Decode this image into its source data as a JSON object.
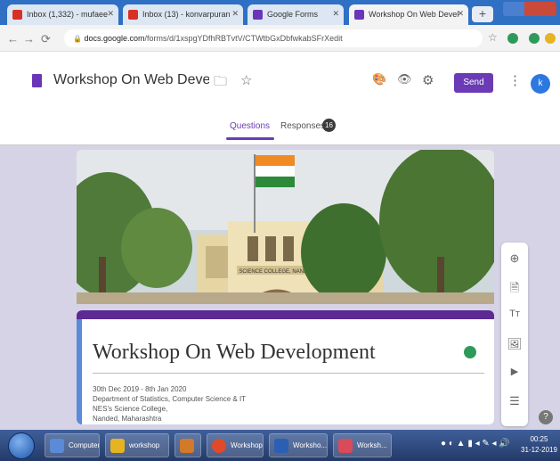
{
  "browser": {
    "tabs": [
      {
        "label": "Inbox (1,332) - mufaee",
        "favicon_color": "#d93025"
      },
      {
        "label": "Inbox (13) - konvarpuran",
        "favicon_color": "#d93025"
      },
      {
        "label": "Google Forms",
        "favicon_color": "#6a36b8"
      },
      {
        "label": "Workshop On Web Devel",
        "favicon_color": "#6a36b8"
      }
    ],
    "active_tab_index": 3,
    "new_tab_label": "+",
    "url_host": "docs.google.com",
    "url_path": "/forms/d/1xspgYDfhRBTvtV/CTWtbGxDbfwkabSFrXedit",
    "nav": {
      "back": "←",
      "forward": "→",
      "reload": "⟳",
      "lock": "🔒"
    },
    "star_icon": "☆"
  },
  "forms_header": {
    "title": "Workshop On Web Developr",
    "folder_icon": "🗀",
    "star_icon": "☆",
    "palette_icon": "🎨",
    "preview_icon": "👁",
    "settings_icon": "⚙",
    "send_label": "Send",
    "more_icon": "⋮",
    "avatar_letter": "k",
    "tabs": {
      "questions": "Questions",
      "responses": "Responses",
      "responses_count": "16"
    }
  },
  "form": {
    "title": "Workshop On Web Development",
    "description_lines": [
      "30th Dec 2019 - 8th Jan 2020",
      "Department of Statistics, Computer Science & IT",
      "NES's Science College,",
      "Nanded, Maharashtra"
    ],
    "banner_college_name": "SCIENCE COLLEGE, NANDED"
  },
  "toolbar": {
    "items": [
      {
        "name": "add-question-icon",
        "glyph": "⊕"
      },
      {
        "name": "import-questions-icon",
        "glyph": "🗎"
      },
      {
        "name": "add-title-icon",
        "glyph": "Tт"
      },
      {
        "name": "add-image-icon",
        "glyph": "🖼"
      },
      {
        "name": "add-video-icon",
        "glyph": "▶"
      },
      {
        "name": "add-section-icon",
        "glyph": "☰"
      }
    ],
    "help_icon": "?"
  },
  "taskbar": {
    "buttons": [
      {
        "label": "Computer",
        "icon_color": "#5b8ad8"
      },
      {
        "label": "workshop",
        "icon_color": "#e6b422"
      },
      {
        "label": "",
        "icon_color": "#d07a2a"
      },
      {
        "label": "Workshop ...",
        "icon_color": "#e04a2a"
      },
      {
        "label": "Worksho...",
        "icon_color": "#2b5fb3"
      },
      {
        "label": "Worksh...",
        "icon_color": "#d94a5a"
      }
    ],
    "tray_icons": "● ◐ ▲ ▮ ◂ ✎ ◂ 🔊",
    "clock_time": "00:25",
    "clock_date": "31-12-2019"
  },
  "colors": {
    "accent": "#6a3bb5",
    "form_bg": "#d7d3e6",
    "chrome_blue": "#2f6fc4"
  }
}
